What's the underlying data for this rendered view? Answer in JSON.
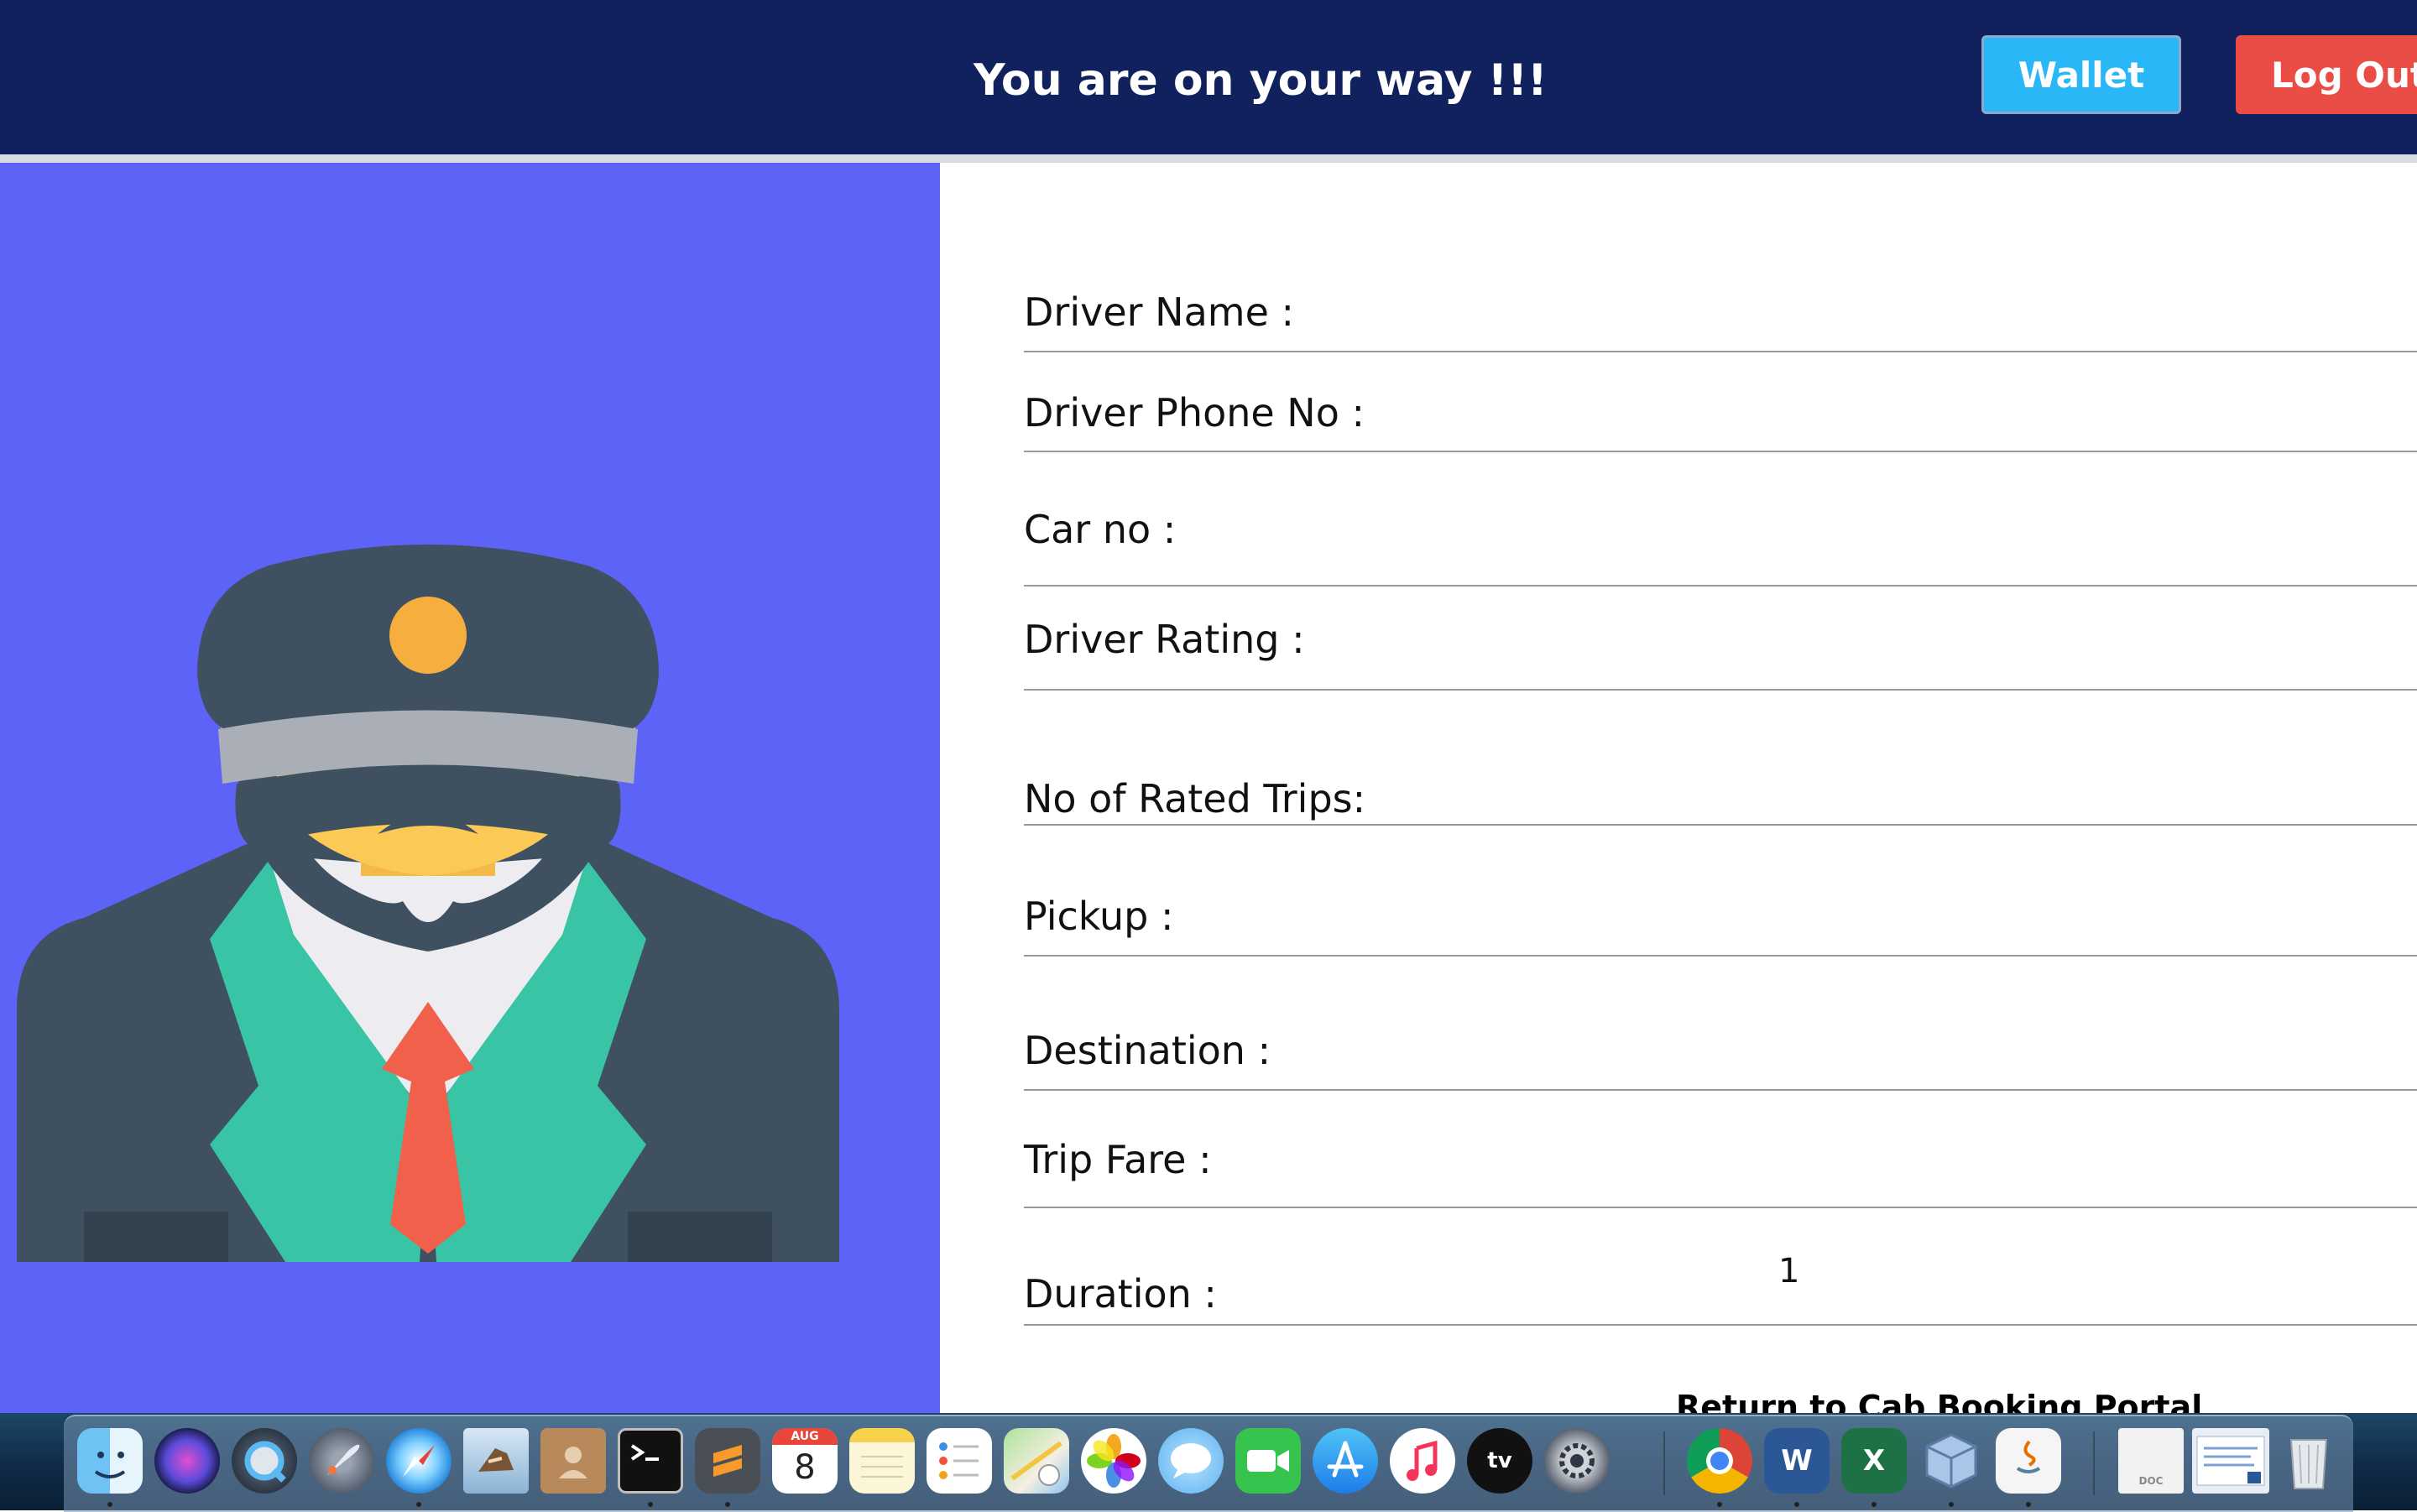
{
  "header": {
    "title": "You are on your way !!!",
    "wallet_label": "Wallet",
    "logout_label": "Log Out"
  },
  "colors": {
    "header_bg": "#10215d",
    "left_panel_bg": "#5d63f6",
    "wallet_button": "#2ab7f8",
    "logout_button": "#ea4c46"
  },
  "avatar": {
    "icon": "driver-avatar-illustration"
  },
  "form": {
    "fields": [
      {
        "label": "Driver Name :",
        "value": ""
      },
      {
        "label": "Driver Phone No :",
        "value": ""
      },
      {
        "label": "Car no :",
        "value": ""
      },
      {
        "label": "Driver Rating :",
        "value": ""
      },
      {
        "label": "No of Rated Trips:",
        "value": ""
      },
      {
        "label": "Pickup :",
        "value": ""
      },
      {
        "label": "Destination :",
        "value": ""
      },
      {
        "label": "Trip Fare :",
        "value": ""
      },
      {
        "label": "Duration :",
        "value": "1"
      }
    ],
    "return_link": "Return to Cab Booking Portal"
  },
  "dock": {
    "calendar_month": "AUG",
    "calendar_day": "8",
    "tv_label": "tv",
    "word_letter": "W",
    "excel_letter": "X",
    "doc_label": "DOC",
    "items": [
      {
        "name": "finder-icon"
      },
      {
        "name": "siri-icon"
      },
      {
        "name": "quicktime-icon"
      },
      {
        "name": "launchpad-icon"
      },
      {
        "name": "safari-icon"
      },
      {
        "name": "mail-icon"
      },
      {
        "name": "contacts-icon"
      },
      {
        "name": "terminal-icon"
      },
      {
        "name": "sublime-text-icon"
      },
      {
        "name": "calendar-icon"
      },
      {
        "name": "notes-icon"
      },
      {
        "name": "reminders-icon"
      },
      {
        "name": "maps-icon"
      },
      {
        "name": "photos-icon"
      },
      {
        "name": "messages-icon"
      },
      {
        "name": "facetime-icon"
      },
      {
        "name": "app-store-icon"
      },
      {
        "name": "music-icon"
      },
      {
        "name": "apple-tv-icon"
      },
      {
        "name": "system-preferences-icon"
      },
      {
        "name": "chrome-icon"
      },
      {
        "name": "word-icon"
      },
      {
        "name": "excel-icon"
      },
      {
        "name": "virtualbox-icon"
      },
      {
        "name": "java-icon"
      },
      {
        "name": "document-icon"
      },
      {
        "name": "word-document-icon"
      },
      {
        "name": "trash-icon"
      }
    ]
  }
}
